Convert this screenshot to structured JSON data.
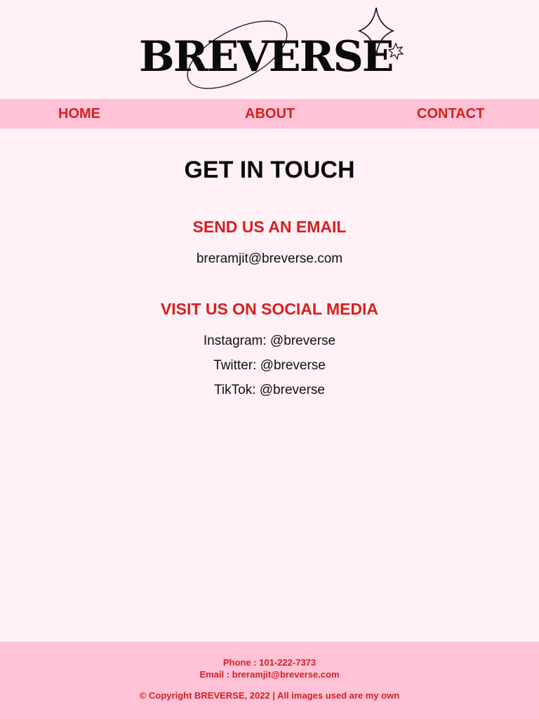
{
  "brand": {
    "logo_text": "BREVERSE"
  },
  "nav": {
    "home": "HOME",
    "about": "ABOUT",
    "contact": "CONTACT"
  },
  "main": {
    "title": "GET IN TOUCH",
    "email_heading": "SEND US AN EMAIL",
    "email_address": "breramjit@breverse.com",
    "social_heading": "VISIT US ON SOCIAL MEDIA",
    "social": [
      "Instagram: @breverse",
      "Twitter: @breverse",
      "TikTok: @breverse"
    ]
  },
  "footer": {
    "phone": "Phone : 101-222-7373",
    "email": "Email : breramjit@breverse.com",
    "copyright": "© Copyright BREVERSE, 2022 | All images used are my own"
  },
  "colors": {
    "background": "#fff1f5",
    "bar": "#ffc2d6",
    "accent_red": "#d62020",
    "text_dark": "#0a0a0a"
  },
  "icons": {
    "logo_decoration": "ellipse-orbit-and-sparkle-stars"
  }
}
